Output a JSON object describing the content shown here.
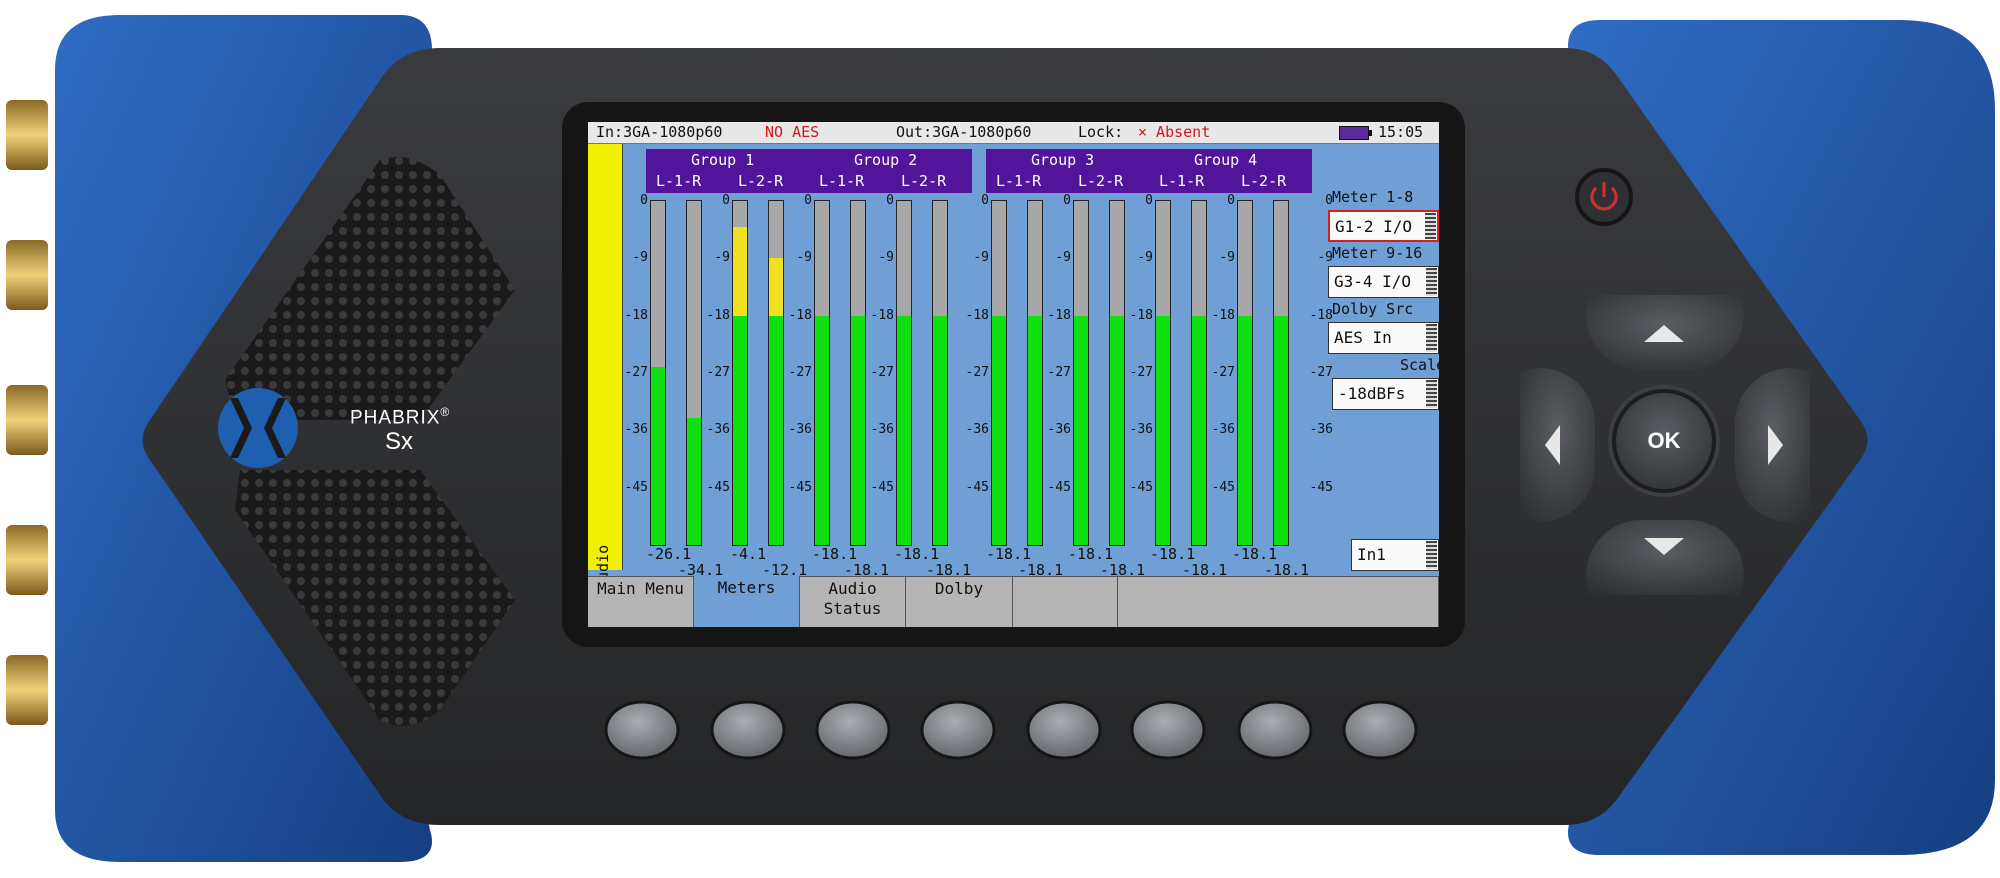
{
  "device": {
    "brand": "PHABRIX",
    "reg": "®",
    "model": "Sx"
  },
  "status": {
    "input": "In:3GA-1080p60",
    "aes": "NO AES",
    "output": "Out:3GA-1080p60",
    "lock_label": "Lock:",
    "lock_value": "× Absent",
    "time": "15:05"
  },
  "sidebar_tab": "Audio",
  "groups": [
    {
      "name": "Group 1",
      "channels": [
        "L-1-R",
        "L-2-R"
      ]
    },
    {
      "name": "Group 2",
      "channels": [
        "L-1-R",
        "L-2-R"
      ]
    },
    {
      "name": "Group 3",
      "channels": [
        "L-1-R",
        "L-2-R"
      ]
    },
    {
      "name": "Group 4",
      "channels": [
        "L-1-R",
        "L-2-R"
      ]
    }
  ],
  "scale_labels": [
    "0",
    "-9",
    "-18",
    "-27",
    "-36",
    "-45"
  ],
  "meters": [
    {
      "level": -26.1,
      "peak": -26.1
    },
    {
      "level": -34.1,
      "peak": -34.1
    },
    {
      "level": -18.1,
      "peak": -4.1
    },
    {
      "level": -18.1,
      "peak": -12.1
    },
    {
      "level": -18.1,
      "peak": -18.1
    },
    {
      "level": -18.1,
      "peak": -18.1
    },
    {
      "level": -18.1,
      "peak": -18.1
    },
    {
      "level": -18.1,
      "peak": -18.1
    },
    {
      "level": -18.1,
      "peak": -18.1
    },
    {
      "level": -18.1,
      "peak": -18.1
    },
    {
      "level": -18.1,
      "peak": -18.1
    },
    {
      "level": -18.1,
      "peak": -18.1
    },
    {
      "level": -18.1,
      "peak": -18.1
    },
    {
      "level": -18.1,
      "peak": -18.1
    },
    {
      "level": -18.1,
      "peak": -18.1
    },
    {
      "level": -18.1,
      "peak": -18.1
    }
  ],
  "readouts": {
    "top": [
      "-26.1",
      "-4.1",
      "-18.1",
      "-18.1",
      "-18.1",
      "-18.1",
      "-18.1",
      "-18.1"
    ],
    "bottom": [
      "-34.1",
      "-12.1",
      "-18.1",
      "-18.1",
      "-18.1",
      "-18.1",
      "-18.1",
      "-18.1"
    ]
  },
  "settings": {
    "meter_1_8_label": "Meter 1-8",
    "meter_1_8_value": "G1-2 I/O",
    "meter_9_16_label": "Meter 9-16",
    "meter_9_16_value": "G3-4 I/O",
    "dolby_src_label": "Dolby Src",
    "dolby_src_value": "AES In",
    "scale_label": "Scale",
    "scale_value": "-18dBFs",
    "input_value": "In1"
  },
  "tabs": [
    {
      "label": "Main Menu",
      "active": false
    },
    {
      "label": "Meters",
      "active": true
    },
    {
      "label": "Audio Status",
      "active": false
    },
    {
      "label": "Dolby",
      "active": false
    },
    {
      "label": "",
      "active": false
    },
    {
      "label": "",
      "active": false
    }
  ],
  "dpad": {
    "ok_label": "OK"
  },
  "colors": {
    "body_blue": "#1f56a8",
    "body_dark": "#2c2d2f",
    "screen_bg": "#6f9fd4",
    "group_purple": "#52149a",
    "meter_green": "#10e010",
    "meter_yellow": "#f0e020",
    "meter_red": "#e02020",
    "alert_red": "#d01818"
  }
}
